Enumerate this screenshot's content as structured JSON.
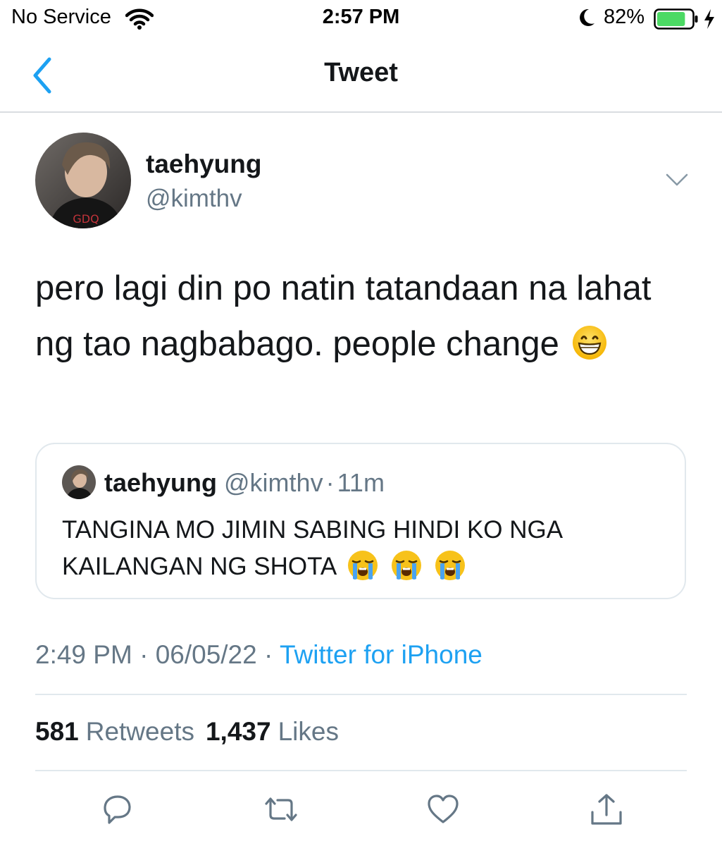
{
  "status_bar": {
    "carrier": "No Service",
    "time": "2:57 PM",
    "battery_percent": "82%",
    "battery_level": 0.82
  },
  "nav": {
    "title": "Tweet"
  },
  "tweet": {
    "author_name": "taehyung",
    "author_handle": "@kimthv",
    "text": "pero lagi din po natin tatandaan na lahat ng tao nagbabago. people change",
    "emoji": "grinning-face",
    "timestamp": "2:49 PM",
    "date": "06/05/22",
    "source": "Twitter for iPhone",
    "retweets_count": "581",
    "retweets_label": "Retweets",
    "likes_count": "1,437",
    "likes_label": "Likes"
  },
  "quoted_tweet": {
    "author_name": "taehyung",
    "author_handle": "@kimthv",
    "time_ago": "11m",
    "text": "TANGINA MO JIMIN SABING HINDI KO NGA KAILANGAN NG SHOTA",
    "emojis": [
      "loudly-crying-face",
      "loudly-crying-face",
      "loudly-crying-face"
    ]
  },
  "separator": "·",
  "actions": [
    "reply-icon",
    "retweet-icon",
    "like-icon",
    "share-icon"
  ],
  "colors": {
    "accent": "#1da1f2",
    "secondary_text": "#657786",
    "battery": "#4cd964"
  }
}
